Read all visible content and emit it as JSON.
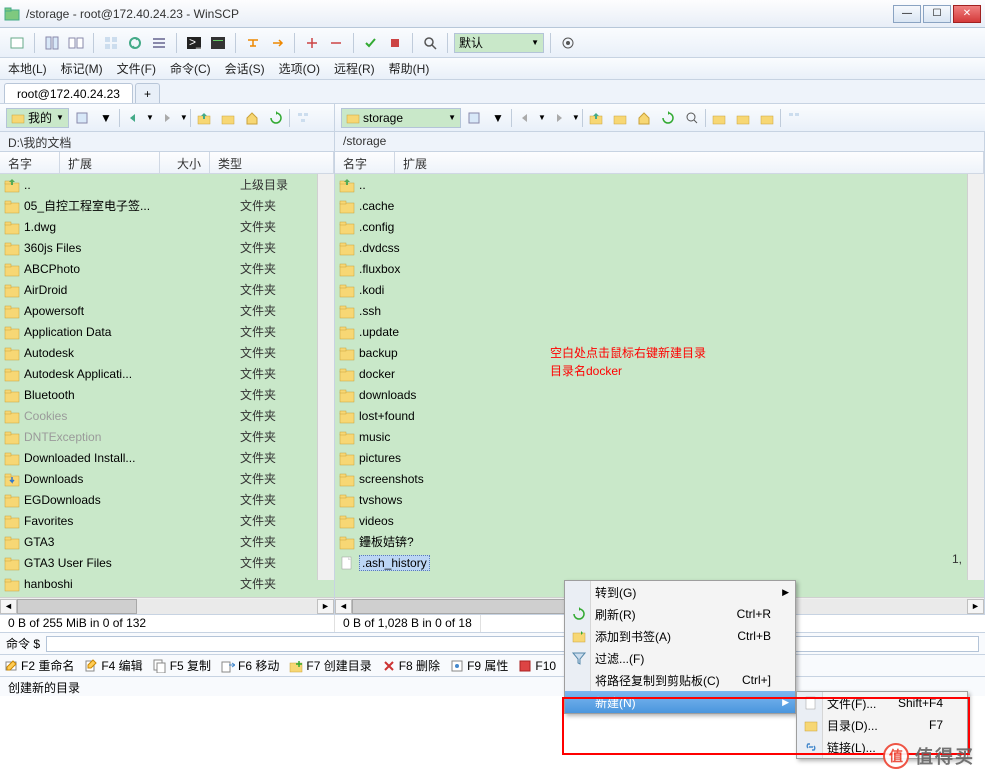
{
  "window": {
    "title": "/storage - root@172.40.24.23 - WinSCP"
  },
  "winbuttons": {
    "min": "—",
    "max": "☐",
    "close": "✕"
  },
  "toolbar": {
    "preset_label": "默认"
  },
  "menubar": {
    "local": "本地(L)",
    "mark": "标记(M)",
    "files": "文件(F)",
    "commands": "命令(C)",
    "session": "会话(S)",
    "options": "选项(O)",
    "remote": "远程(R)",
    "help": "帮助(H)"
  },
  "session_tab": "root@172.40.24.23",
  "tab_add": "+",
  "local_drive": "我的",
  "remote_drive": "storage",
  "local_path": "D:\\我的文档",
  "remote_path": "/storage",
  "headers": {
    "name": "名字",
    "ext": "扩展",
    "size": "大小",
    "type": "类型"
  },
  "local_files": [
    {
      "name": "..",
      "type": "上级目录",
      "up": true
    },
    {
      "name": "05_自控工程室电子签...",
      "type": "文件夹"
    },
    {
      "name": "1.dwg",
      "type": "文件夹"
    },
    {
      "name": "360js Files",
      "type": "文件夹"
    },
    {
      "name": "ABCPhoto",
      "type": "文件夹"
    },
    {
      "name": "AirDroid",
      "type": "文件夹"
    },
    {
      "name": "Apowersoft",
      "type": "文件夹"
    },
    {
      "name": "Application Data",
      "type": "文件夹"
    },
    {
      "name": "Autodesk",
      "type": "文件夹"
    },
    {
      "name": "Autodesk Applicati...",
      "type": "文件夹"
    },
    {
      "name": "Bluetooth",
      "type": "文件夹"
    },
    {
      "name": "Cookies",
      "type": "文件夹",
      "dim": true
    },
    {
      "name": "DNTException",
      "type": "文件夹",
      "dim": true
    },
    {
      "name": "Downloaded Install...",
      "type": "文件夹"
    },
    {
      "name": "Downloads",
      "type": "文件夹",
      "dl": true
    },
    {
      "name": "EGDownloads",
      "type": "文件夹"
    },
    {
      "name": "Favorites",
      "type": "文件夹"
    },
    {
      "name": "GTA3",
      "type": "文件夹"
    },
    {
      "name": "GTA3 User Files",
      "type": "文件夹"
    },
    {
      "name": "hanboshi",
      "type": "文件夹"
    }
  ],
  "remote_files": [
    {
      "name": "..",
      "up": true
    },
    {
      "name": ".cache"
    },
    {
      "name": ".config"
    },
    {
      "name": ".dvdcss"
    },
    {
      "name": ".fluxbox"
    },
    {
      "name": ".kodi"
    },
    {
      "name": ".ssh"
    },
    {
      "name": ".update"
    },
    {
      "name": "backup"
    },
    {
      "name": "docker"
    },
    {
      "name": "downloads"
    },
    {
      "name": "lost+found"
    },
    {
      "name": "music"
    },
    {
      "name": "pictures"
    },
    {
      "name": "screenshots"
    },
    {
      "name": "tvshows"
    },
    {
      "name": "videos"
    },
    {
      "name": "鑸板姞锛?"
    },
    {
      "name": ".ash_history",
      "file": true,
      "sel": true
    }
  ],
  "remote_size_hint": "1,",
  "status": {
    "local": "0 B of 255 MiB in 0 of 132",
    "remote": "0 B of 1,028 B in 0 of 18"
  },
  "cmd_label": "命令 $",
  "fnbar": {
    "f2": "F2 重命名",
    "f4": "F4 编辑",
    "f5": "F5 复制",
    "f6": "F6 移动",
    "f7": "F7 创建目录",
    "f8": "F8 删除",
    "f9": "F9 属性",
    "f10": "F10"
  },
  "status2": "创建新的目录",
  "annotation": {
    "line1": "空白处点击鼠标右键新建目录",
    "line2": "目录名docker"
  },
  "ctx": {
    "goto": "转到(G)",
    "refresh": "刷新(R)",
    "refresh_sc": "Ctrl+R",
    "bookmark": "添加到书签(A)",
    "bookmark_sc": "Ctrl+B",
    "filter": "过滤...(F)",
    "copypath": "将路径复制到剪贴板(C)",
    "copypath_sc": "Ctrl+]",
    "new": "新建(N)"
  },
  "submenu": {
    "file": "文件(F)...",
    "file_sc": "Shift+F4",
    "dir": "目录(D)...",
    "dir_sc": "F7",
    "link": "链接(L)..."
  },
  "watermark": "值得买"
}
